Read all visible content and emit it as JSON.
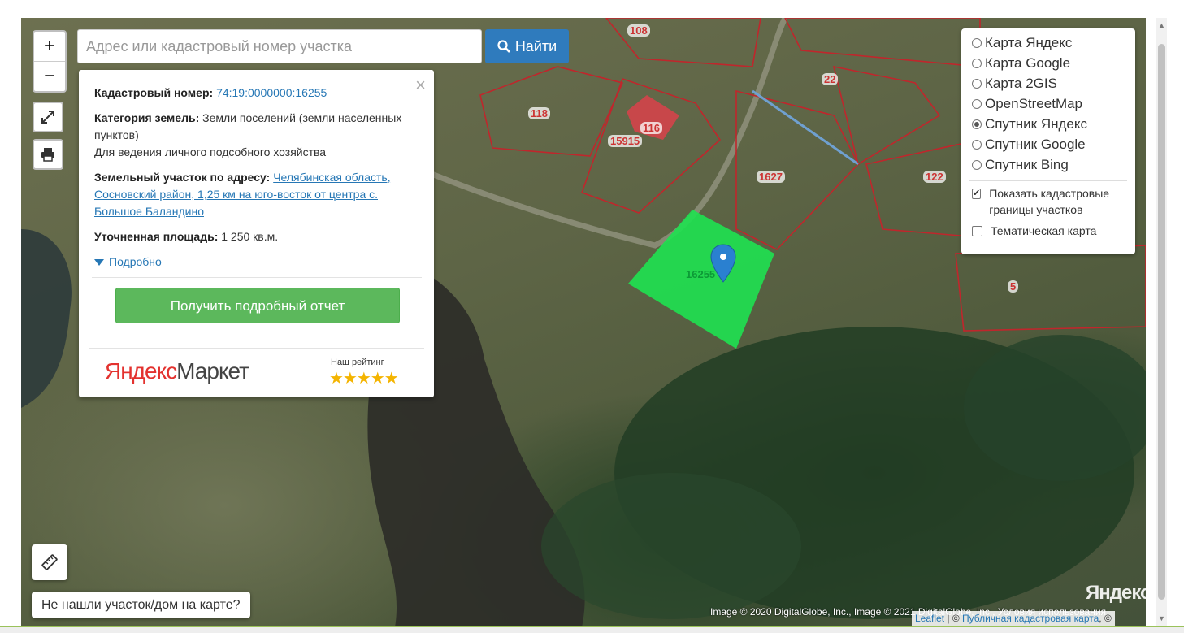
{
  "search": {
    "placeholder": "Адрес или кадастровый номер участка",
    "button_label": "Найти"
  },
  "zoom": {
    "in_label": "+",
    "out_label": "−"
  },
  "popup": {
    "close_label": "×",
    "cadastral_label": "Кадастровый номер:",
    "cadastral_value": "74:19:0000000:16255",
    "category_label": "Категория земель:",
    "category_value": "Земли поселений (земли населенных пунктов)",
    "usage_value": "Для ведения личного подсобного хозяйства",
    "address_label": "Земельный участок по адресу:",
    "address_value": "Челябинская область, Сосновский район, 1,25 км на юго-восток от центра с. Большое Баландино",
    "area_label": "Уточненная площадь:",
    "area_value": "1 250 кв.м.",
    "more_label": "Подробно",
    "report_button": "Получить подробный отчет",
    "ad": {
      "logo_red": "Яндекс",
      "logo_gray": "Маркет",
      "rating_label": "Наш рейтинг",
      "stars": "★★★★★"
    }
  },
  "layers": {
    "options": [
      {
        "label": "Карта Яндекс",
        "selected": false
      },
      {
        "label": "Карта Google",
        "selected": false
      },
      {
        "label": "Карта 2GIS",
        "selected": false
      },
      {
        "label": "OpenStreetMap",
        "selected": false
      },
      {
        "label": "Спутник Яндекс",
        "selected": true
      },
      {
        "label": "Спутник Google",
        "selected": false
      },
      {
        "label": "Спутник Bing",
        "selected": false
      }
    ],
    "overlays": [
      {
        "label": "Показать кадастровые границы участков",
        "checked": true
      },
      {
        "label": "Тематическая карта",
        "checked": false
      }
    ]
  },
  "map": {
    "parcel_labels": [
      "108",
      "22",
      "118",
      "116",
      "15915",
      "1627",
      "122",
      "16255",
      "5"
    ],
    "watermark": "Яндекс",
    "copyright": "Image © 2020 DigitalGlobe, Inc., Image © 2021 DigitalGlobe, Inc., Условия использования",
    "attribution_leaflet": "Leaflet",
    "attribution_sep": " | © ",
    "attribution_link": "Публичная кадастровая карта",
    "attribution_tail": ", ©"
  },
  "notfound_label": "Не нашли участок/дом на карте?",
  "colors": {
    "parcel_fill": "#1fe050",
    "boundary": "#c0262c",
    "search_button": "#2f7bbd",
    "report_button": "#5cb85c",
    "marker": "#2a80d0"
  }
}
